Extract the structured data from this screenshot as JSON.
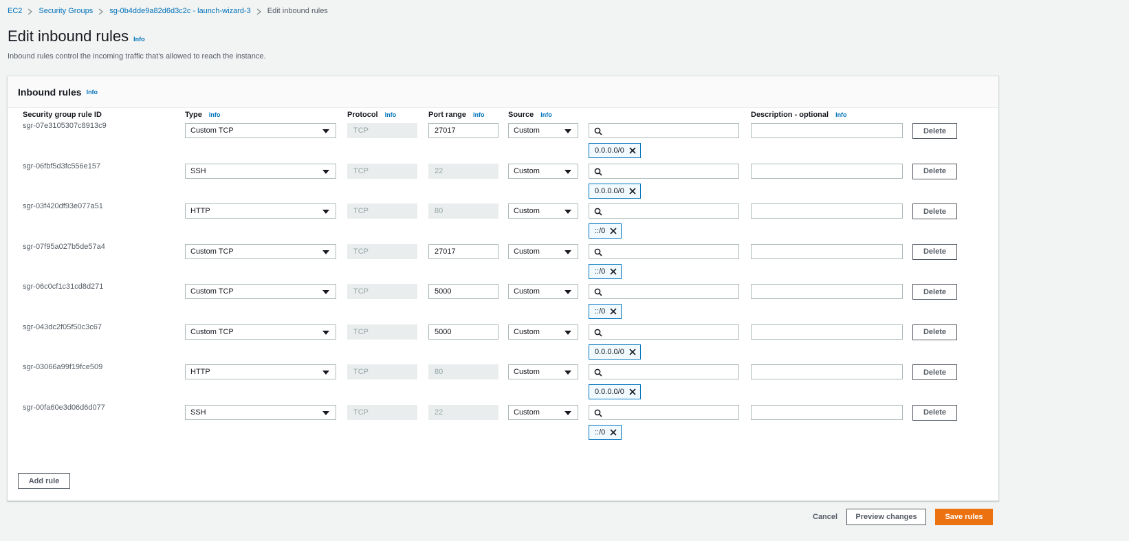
{
  "breadcrumb": {
    "items": [
      "EC2",
      "Security Groups",
      "sg-0b4dde9a82d6d3c2c - launch-wizard-3",
      "Edit inbound rules"
    ]
  },
  "page": {
    "title": "Edit inbound rules",
    "info": "Info",
    "description": "Inbound rules control the incoming traffic that's allowed to reach the instance."
  },
  "panel": {
    "title": "Inbound rules",
    "info": "Info"
  },
  "columns": {
    "rule_id": "Security group rule ID",
    "type": "Type",
    "protocol": "Protocol",
    "port_range": "Port range",
    "source": "Source",
    "description": "Description - optional",
    "info": "Info"
  },
  "rules": [
    {
      "id": "sgr-07e3105307c8913c9",
      "type": "Custom TCP",
      "protocol": "TCP",
      "port": "27017",
      "port_editable": true,
      "source": "Custom",
      "cidr": "0.0.0.0/0"
    },
    {
      "id": "sgr-06fbf5d3fc556e157",
      "type": "SSH",
      "protocol": "TCP",
      "port": "22",
      "port_editable": false,
      "source": "Custom",
      "cidr": "0.0.0.0/0"
    },
    {
      "id": "sgr-03f420df93e077a51",
      "type": "HTTP",
      "protocol": "TCP",
      "port": "80",
      "port_editable": false,
      "source": "Custom",
      "cidr": "::/0"
    },
    {
      "id": "sgr-07f95a027b5de57a4",
      "type": "Custom TCP",
      "protocol": "TCP",
      "port": "27017",
      "port_editable": true,
      "source": "Custom",
      "cidr": "::/0"
    },
    {
      "id": "sgr-06c0cf1c31cd8d271",
      "type": "Custom TCP",
      "protocol": "TCP",
      "port": "5000",
      "port_editable": true,
      "source": "Custom",
      "cidr": "::/0"
    },
    {
      "id": "sgr-043dc2f05f50c3c67",
      "type": "Custom TCP",
      "protocol": "TCP",
      "port": "5000",
      "port_editable": true,
      "source": "Custom",
      "cidr": "0.0.0.0/0"
    },
    {
      "id": "sgr-03066a99f19fce509",
      "type": "HTTP",
      "protocol": "TCP",
      "port": "80",
      "port_editable": false,
      "source": "Custom",
      "cidr": "0.0.0.0/0"
    },
    {
      "id": "sgr-00fa60e3d06d6d077",
      "type": "SSH",
      "protocol": "TCP",
      "port": "22",
      "port_editable": false,
      "source": "Custom",
      "cidr": "::/0"
    }
  ],
  "buttons": {
    "delete": "Delete",
    "add_rule": "Add rule",
    "cancel": "Cancel",
    "preview": "Preview changes",
    "save": "Save rules"
  },
  "icons": {
    "search": "search-icon",
    "remove": "close-icon",
    "dropdown": "caret-down-icon",
    "separator": "chevron-right-icon"
  },
  "colors": {
    "link": "#0073bb",
    "primary": "#ec7211",
    "background": "#f2f3f3"
  }
}
